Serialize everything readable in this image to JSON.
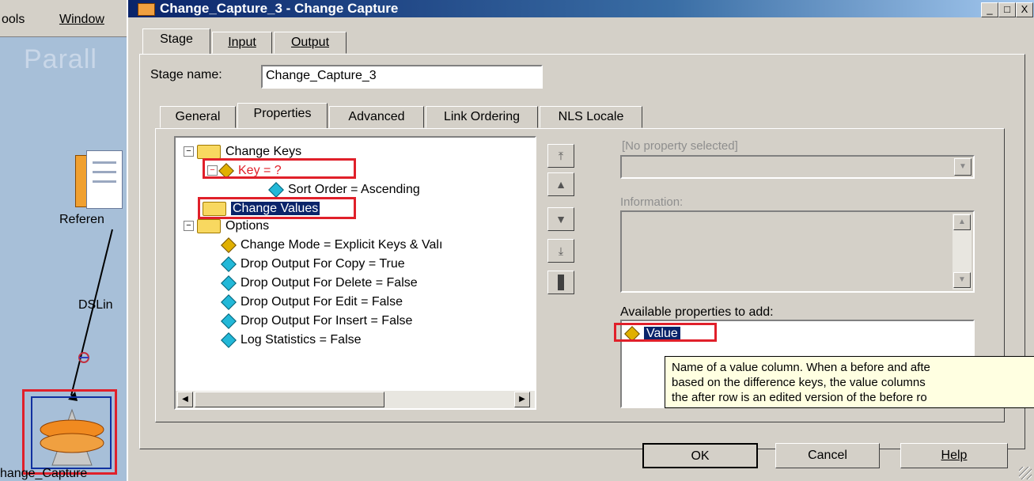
{
  "background": {
    "menu_tools": "ools",
    "menu_window": "Window",
    "canvas_title": "Parall",
    "reference_label": "Referen",
    "link_label": "DSLin",
    "stage_label": "hange_Capture"
  },
  "dialog": {
    "title": "Change_Capture_3 - Change Capture",
    "title_buttons": [
      "_",
      "□",
      "X"
    ],
    "main_tabs": [
      "Stage",
      "Input",
      "Output"
    ],
    "stage_name_label": "Stage name:",
    "stage_name_value": "Change_Capture_3",
    "sub_tabs": [
      "General",
      "Properties",
      "Advanced",
      "Link Ordering",
      "NLS Locale"
    ],
    "tree": {
      "change_keys": "Change Keys",
      "key": "Key = ?",
      "sort_order": "Sort Order = Ascending",
      "change_values": "Change Values",
      "options": "Options",
      "option_items": [
        "Change Mode = Explicit Keys & Valı",
        "Drop Output For Copy = True",
        "Drop Output For Delete = False",
        "Drop Output For Edit = False",
        "Drop Output For Insert = False",
        "Log Statistics = False"
      ]
    },
    "no_property_label": "[No property selected]",
    "information_label": "Information:",
    "available_label": "Available properties to add:",
    "available_items": [
      "Value"
    ],
    "tooltip_lines": [
      "Name of a value column. When a before and afte",
      "based on the difference keys, the value columns",
      "the after row is an edited version of the before ro"
    ],
    "buttons": {
      "ok": "OK",
      "cancel": "Cancel",
      "help": "Help"
    }
  },
  "colors": {
    "highlight_box": "#e0202a",
    "selection": "#0a246a",
    "tooltip_bg": "#ffffe1"
  }
}
